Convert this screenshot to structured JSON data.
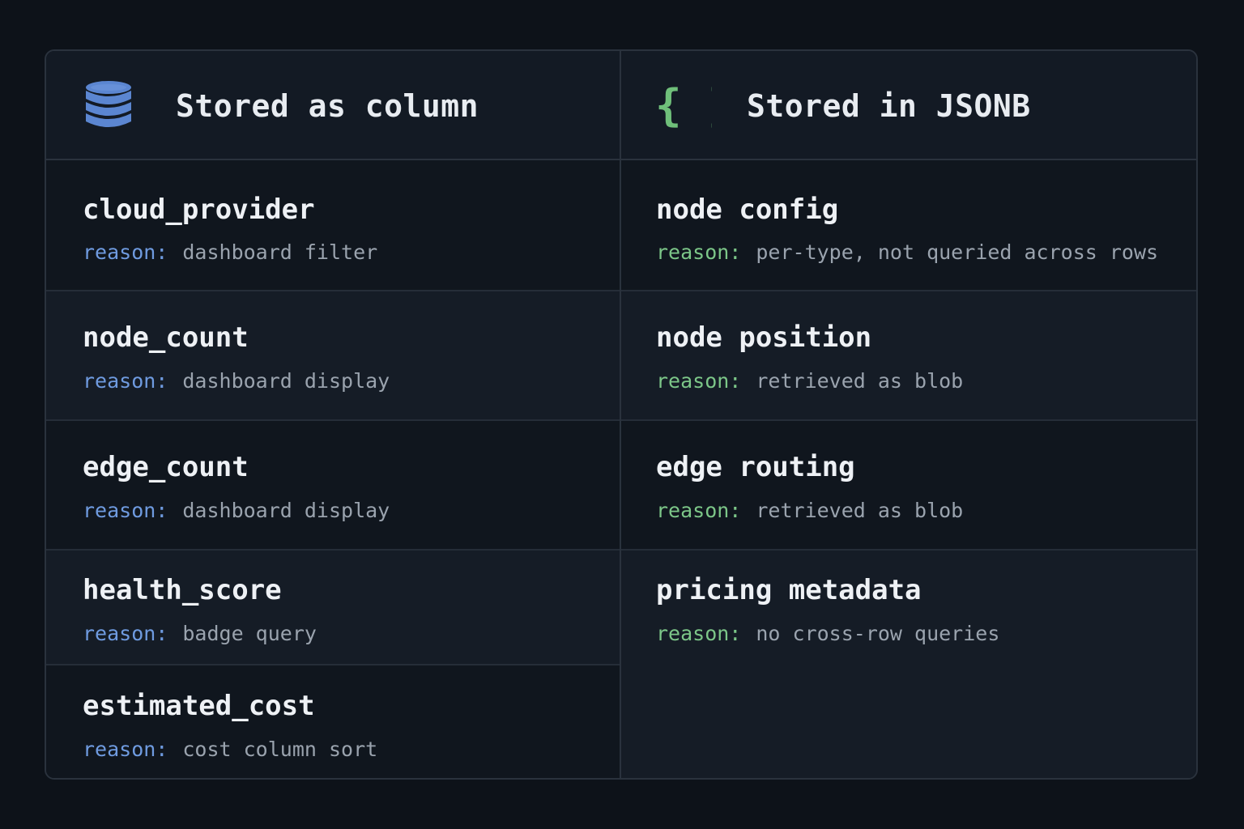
{
  "colors": {
    "column_accent": "#5b86d1",
    "jsonb_accent": "#6fbf7a",
    "background": "#0d1219",
    "panel": "#121821"
  },
  "left": {
    "icon": "database-icon",
    "title": "Stored as column",
    "rows": [
      {
        "field": "cloud_provider",
        "reason_label": "reason:",
        "reason": "dashboard filter"
      },
      {
        "field": "node_count",
        "reason_label": "reason:",
        "reason": "dashboard display"
      },
      {
        "field": "edge_count",
        "reason_label": "reason:",
        "reason": "dashboard display"
      },
      {
        "field": "health_score",
        "reason_label": "reason:",
        "reason": "badge query"
      },
      {
        "field": "estimated_cost",
        "reason_label": "reason:",
        "reason": "cost column sort"
      }
    ]
  },
  "right": {
    "icon": "curly-braces-icon",
    "icon_text": "{ }",
    "title": "Stored in JSONB",
    "rows": [
      {
        "field": "node config",
        "reason_label": "reason:",
        "reason": "per-type, not queried across rows"
      },
      {
        "field": "node position",
        "reason_label": "reason:",
        "reason": "retrieved as blob"
      },
      {
        "field": "edge routing",
        "reason_label": "reason:",
        "reason": "retrieved as blob"
      },
      {
        "field": "pricing metadata",
        "reason_label": "reason:",
        "reason": "no cross-row queries"
      }
    ]
  }
}
